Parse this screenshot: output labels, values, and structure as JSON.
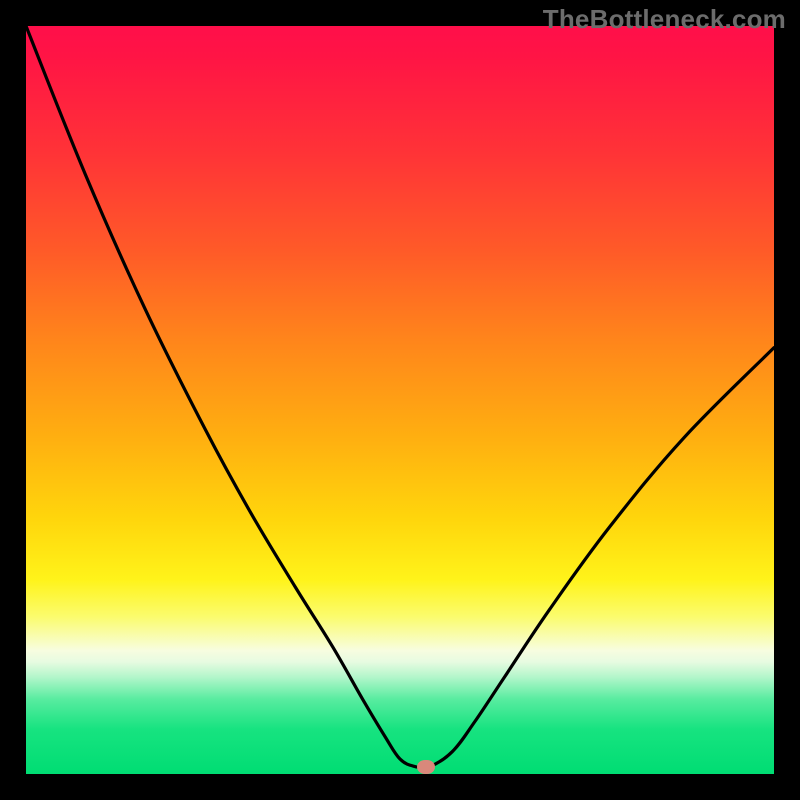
{
  "watermark": "TheBottleneck.com",
  "chart_data": {
    "type": "line",
    "title": "",
    "xlabel": "",
    "ylabel": "",
    "xlim": [
      0,
      100
    ],
    "ylim": [
      0,
      100
    ],
    "grid": false,
    "legend": false,
    "series": [
      {
        "name": "bottleneck-curve",
        "x": [
          0,
          8,
          16,
          24,
          30,
          36,
          41,
          45,
          48,
          50,
          52,
          54,
          57,
          60,
          64,
          70,
          78,
          88,
          100
        ],
        "values": [
          100,
          80,
          62,
          46,
          35,
          25,
          17,
          10,
          5,
          2,
          1,
          1,
          3,
          7,
          13,
          22,
          33,
          45,
          57
        ]
      }
    ],
    "marker": {
      "x": 53.5,
      "y": 1
    },
    "colors": {
      "curve": "#000000",
      "marker": "#d9887b",
      "gradient_top": "#ff0f4a",
      "gradient_bottom": "#00dd73"
    }
  }
}
